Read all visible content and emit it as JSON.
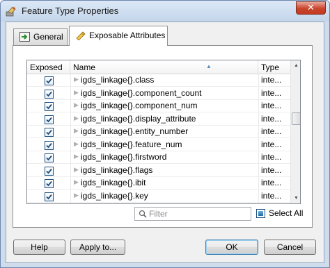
{
  "window": {
    "title": "Feature Type Properties",
    "close_label": "✕"
  },
  "tabs": [
    {
      "label": "General",
      "icon": "general-properties-icon",
      "selected": false
    },
    {
      "label": "Exposable Attributes",
      "icon": "exposable-attributes-icon",
      "selected": true
    }
  ],
  "grid": {
    "columns": [
      "Exposed",
      "Name",
      "Type"
    ],
    "sort_column": "Name",
    "rows": [
      {
        "exposed": true,
        "name": "igds_linkage{}.class",
        "type": "inte..."
      },
      {
        "exposed": true,
        "name": "igds_linkage{}.component_count",
        "type": "inte..."
      },
      {
        "exposed": true,
        "name": "igds_linkage{}.component_num",
        "type": "inte..."
      },
      {
        "exposed": true,
        "name": "igds_linkage{}.display_attribute",
        "type": "inte..."
      },
      {
        "exposed": true,
        "name": "igds_linkage{}.entity_number",
        "type": "inte..."
      },
      {
        "exposed": true,
        "name": "igds_linkage{}.feature_num",
        "type": "inte..."
      },
      {
        "exposed": true,
        "name": "igds_linkage{}.firstword",
        "type": "inte..."
      },
      {
        "exposed": true,
        "name": "igds_linkage{}.flags",
        "type": "inte..."
      },
      {
        "exposed": true,
        "name": "igds_linkage{}.ibit",
        "type": "inte..."
      },
      {
        "exposed": true,
        "name": "igds_linkage{}.key",
        "type": "inte..."
      }
    ]
  },
  "filter": {
    "placeholder": "Filter",
    "value": ""
  },
  "select_all": {
    "label": "Select All",
    "state": "indeterminate"
  },
  "buttons": {
    "help": "Help",
    "apply": "Apply to...",
    "ok": "OK",
    "cancel": "Cancel"
  },
  "colors": {
    "titlebar": "#c4d5ea",
    "close_button": "#c8442c",
    "checkmark": "#1c4c7c"
  }
}
